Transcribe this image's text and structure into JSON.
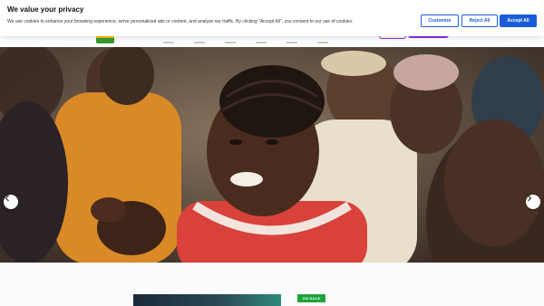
{
  "cookie_banner": {
    "title": "We value your privacy",
    "text": "We use cookies to enhance your browsing experience, serve personalized ads or content, and analyze our traffic. By clicking \"Accept All\", you consent to our use of cookies.",
    "customize_label": "Customize",
    "reject_label": "Reject All",
    "accept_label": "Accept All",
    "accent_color": "#1a5cd8"
  },
  "hero": {
    "prev_icon": "chevron-left-icon",
    "next_icon": "chevron-right-icon"
  },
  "content": {
    "sale_badge": "ON SALE",
    "badge_color": "#1fa33b"
  },
  "header": {
    "brand_color": "#8e2de2"
  }
}
